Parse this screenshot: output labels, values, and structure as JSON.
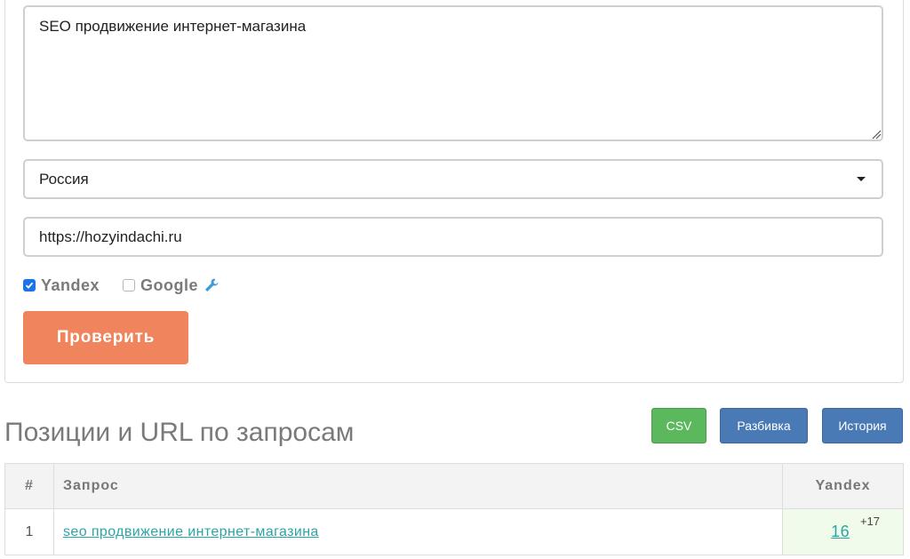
{
  "form": {
    "query_text": "SEO продвижение интернет-магазина",
    "region_value": "Россия",
    "url_value": "https://hozyindachi.ru",
    "engines": [
      {
        "label": "Yandex",
        "checked": true
      },
      {
        "label": "Google",
        "checked": false
      }
    ],
    "submit_label": "Проверить"
  },
  "results": {
    "title": "Позиции и URL по запросам",
    "buttons": {
      "csv": "CSV",
      "split": "Разбивка",
      "history": "История"
    },
    "columns": [
      "#",
      "Запрос",
      "Yandex"
    ],
    "rows": [
      {
        "num": "1",
        "query": "seo продвижение интернет-магазина",
        "yandex": "16",
        "delta": "+17"
      }
    ]
  },
  "colors": {
    "submit": "#f0845c",
    "csv": "#5cb85c",
    "action": "#4a7ab5",
    "link": "#2aa5a5",
    "highlight_cell": "#f1fbeb"
  }
}
